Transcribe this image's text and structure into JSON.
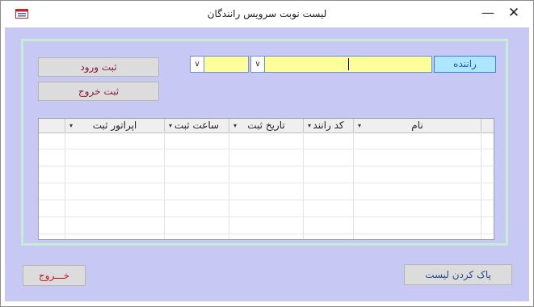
{
  "window": {
    "title": "لیست نوبت سرویس رانندگان",
    "minimize_glyph": "—",
    "close_glyph": "✕"
  },
  "toolbar": {
    "entry_label": "ثبت ورود",
    "exit_register_label": "ثبت خروج"
  },
  "filter": {
    "driver_label": "راننده",
    "driver_name_value": "",
    "driver_code_value": "",
    "dropdown_glyph": "∨"
  },
  "grid": {
    "columns": [
      {
        "label": "نام"
      },
      {
        "label": "کد رانند"
      },
      {
        "label": "تاریخ ثبت"
      },
      {
        "label": "ساعت ثبت"
      },
      {
        "label": "اپراتور ثبت"
      }
    ],
    "sort_glyph": "▾",
    "rows": []
  },
  "footer": {
    "clear_list_label": "پاک کردن لیست",
    "exit_label": "خـــروج"
  },
  "colors": {
    "client_bg": "#c8c8f4",
    "combo_bg": "#ffff99",
    "label_bg": "#aee6ff"
  }
}
